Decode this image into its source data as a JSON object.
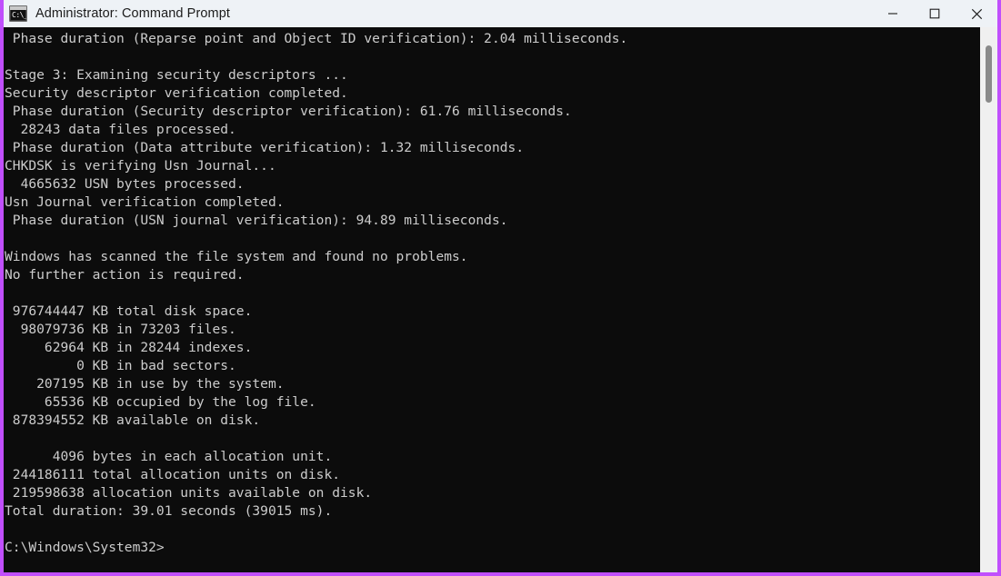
{
  "window": {
    "title": "Administrator: Command Prompt",
    "icon": "command-prompt-icon",
    "icon_glyph": "C:\\_",
    "border_color": "#c04ffc",
    "titlebar_bg": "#eef2f6",
    "terminal_bg": "#0c0c0c",
    "terminal_fg": "#cccccc"
  },
  "controls": {
    "minimize_label": "Minimize",
    "maximize_label": "Maximize",
    "close_label": "Close"
  },
  "terminal": {
    "lines": [
      " Phase duration (Reparse point and Object ID verification): 2.04 milliseconds.",
      "",
      "Stage 3: Examining security descriptors ...",
      "Security descriptor verification completed.",
      " Phase duration (Security descriptor verification): 61.76 milliseconds.",
      "  28243 data files processed.",
      " Phase duration (Data attribute verification): 1.32 milliseconds.",
      "CHKDSK is verifying Usn Journal...",
      "  4665632 USN bytes processed.",
      "Usn Journal verification completed.",
      " Phase duration (USN journal verification): 94.89 milliseconds.",
      "",
      "Windows has scanned the file system and found no problems.",
      "No further action is required.",
      "",
      " 976744447 KB total disk space.",
      "  98079736 KB in 73203 files.",
      "     62964 KB in 28244 indexes.",
      "         0 KB in bad sectors.",
      "    207195 KB in use by the system.",
      "     65536 KB occupied by the log file.",
      " 878394552 KB available on disk.",
      "",
      "      4096 bytes in each allocation unit.",
      " 244186111 total allocation units on disk.",
      " 219598638 allocation units available on disk.",
      "Total duration: 39.01 seconds (39015 ms).",
      "",
      "C:\\Windows\\System32>"
    ]
  },
  "scrollbar": {
    "orientation": "vertical",
    "thumb_position": "near-top"
  }
}
